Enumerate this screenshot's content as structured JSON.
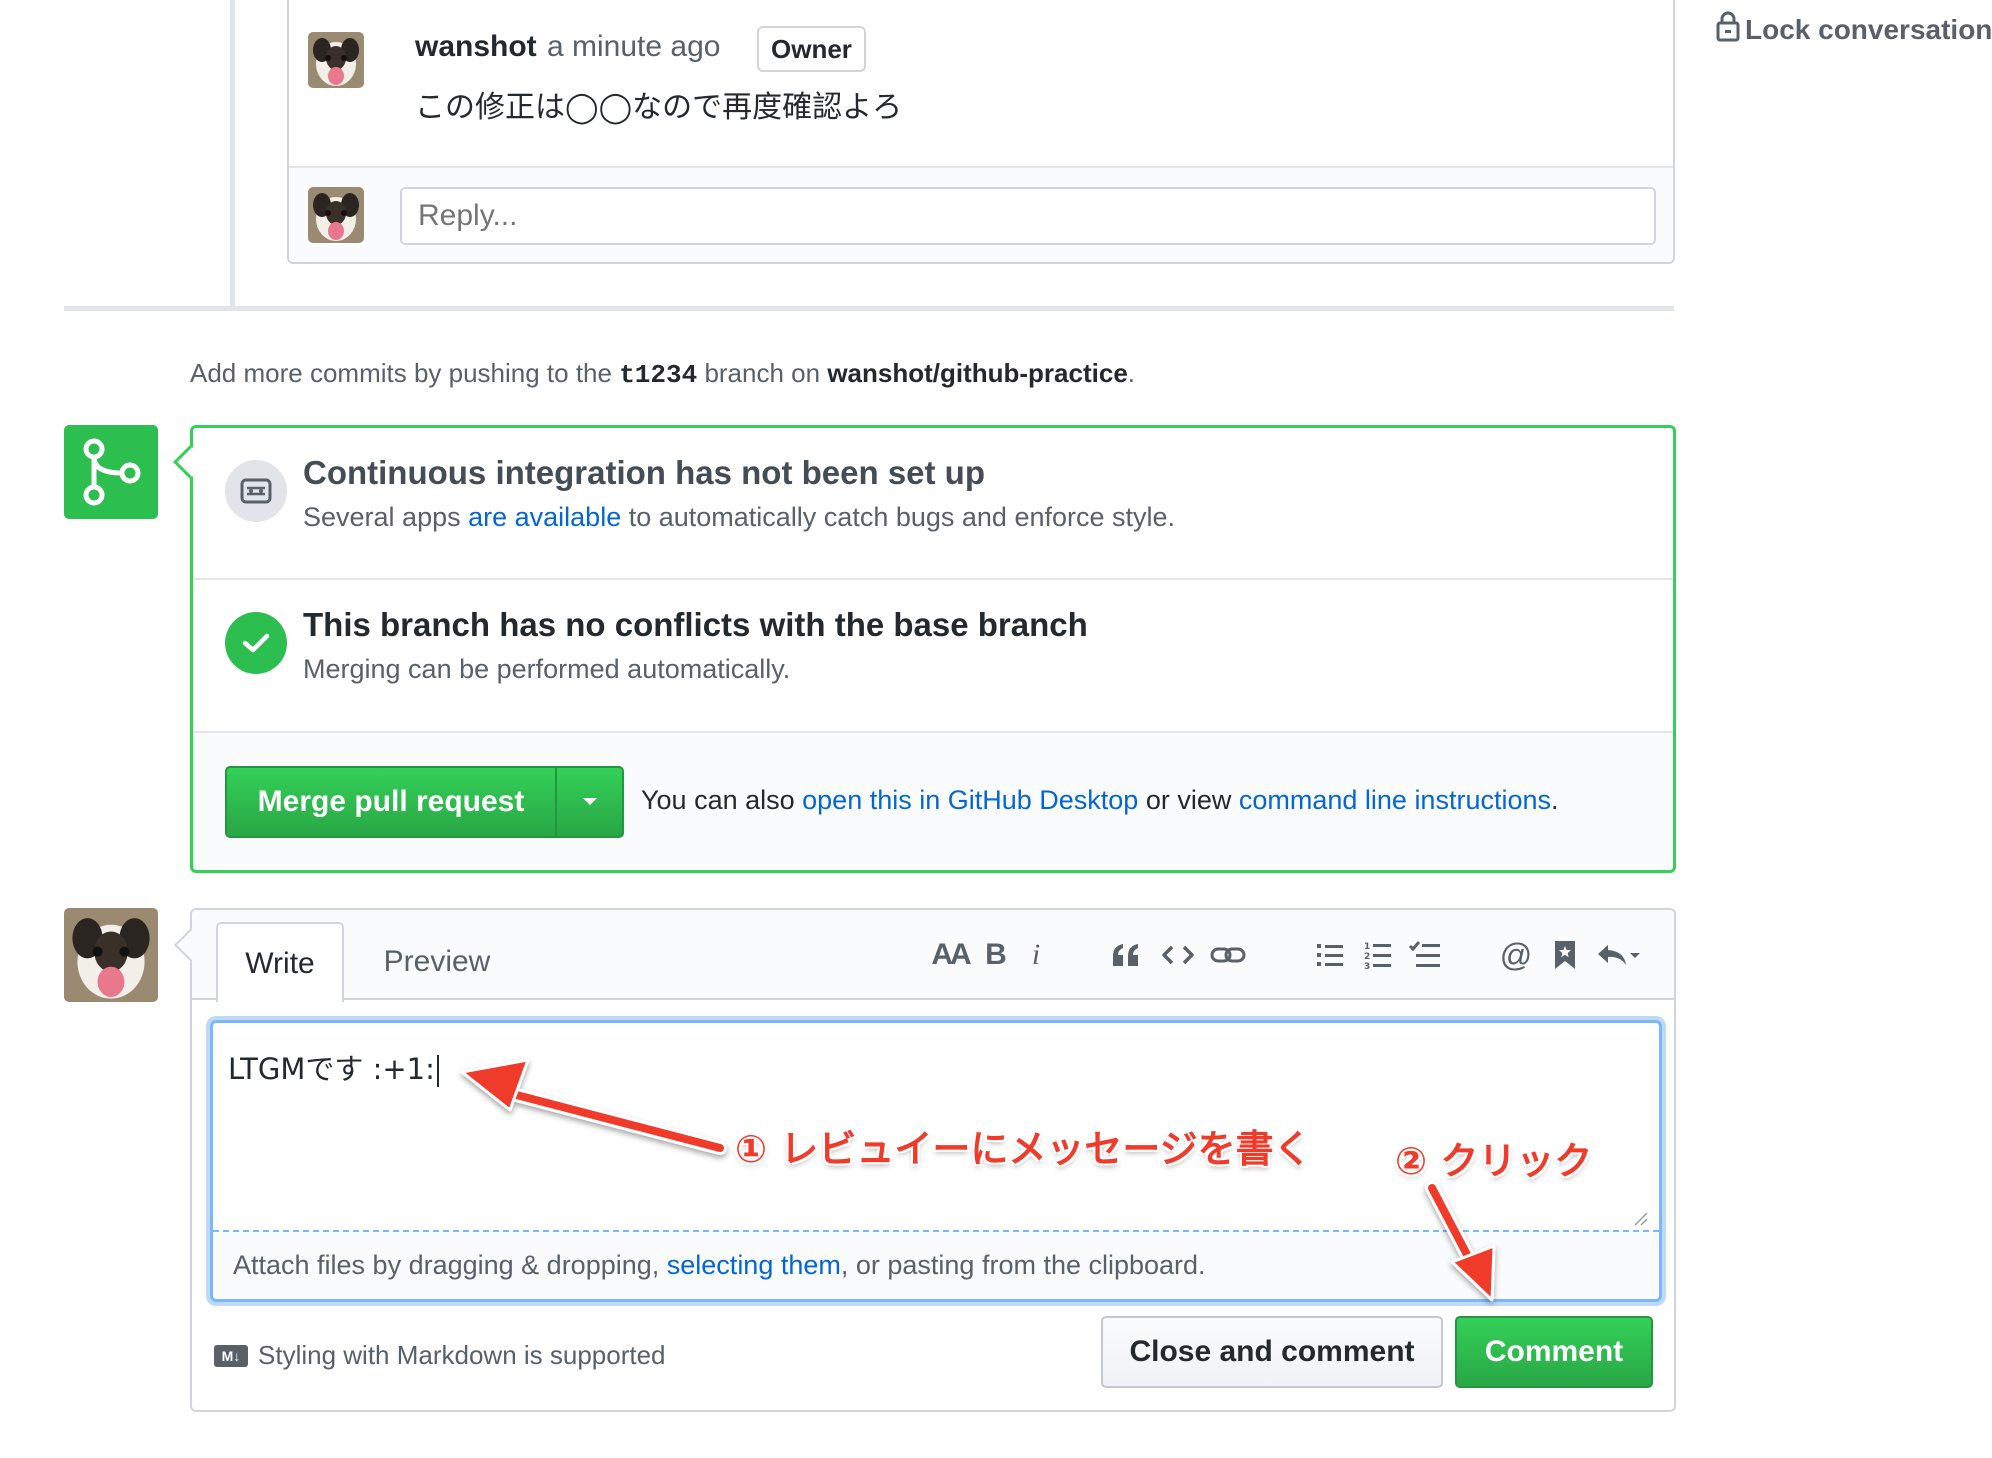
{
  "sidebar": {
    "lock_label": "Lock conversation"
  },
  "review_comment": {
    "author": "wanshot",
    "timestamp": "a minute ago",
    "role_badge": "Owner",
    "body": "この修正は◯◯なので再度確認よろ",
    "reply_placeholder": "Reply..."
  },
  "commits_hint": {
    "prefix": "Add more commits by pushing to the ",
    "branch": "t1234",
    "middle": " branch on ",
    "repo": "wanshot/github-practice",
    "suffix": "."
  },
  "merge_box": {
    "ci_title": "Continuous integration has not been set up",
    "ci_sub_prefix": "Several apps ",
    "ci_sub_link": "are available",
    "ci_sub_suffix": " to automatically catch bugs and enforce style.",
    "conflict_title": "This branch has no conflicts with the base branch",
    "conflict_sub": "Merging can be performed automatically.",
    "merge_button": "Merge pull request",
    "alt_prefix": "You can also ",
    "alt_link_desktop": "open this in GitHub Desktop",
    "alt_middle": " or view ",
    "alt_link_cli": "command line instructions",
    "alt_suffix": "."
  },
  "comment_form": {
    "tabs": [
      "Write",
      "Preview"
    ],
    "toolbar": [
      "header",
      "bold",
      "italic",
      "quote",
      "code",
      "link",
      "unordered-list",
      "ordered-list",
      "task-list",
      "mention",
      "saved-reply",
      "reply"
    ],
    "toolbar_labels": {
      "header": "AA",
      "bold": "B",
      "italic": "i"
    },
    "textarea_value": "LTGMです :+1:",
    "attach_prefix": "Attach files by dragging & dropping, ",
    "attach_link": "selecting them",
    "attach_suffix": ", or pasting from the clipboard.",
    "markdown_hint": "Styling with Markdown is supported",
    "markdown_badge": "M↓",
    "close_button": "Close and comment",
    "comment_button": "Comment"
  },
  "annotations": {
    "step1": "① レビュイーにメッセージを書く",
    "step2": "② クリック"
  },
  "colors": {
    "green": "#2cbe4e",
    "link": "#0366d6",
    "annotation": "#f03a2a",
    "focus": "#79b8ff"
  }
}
